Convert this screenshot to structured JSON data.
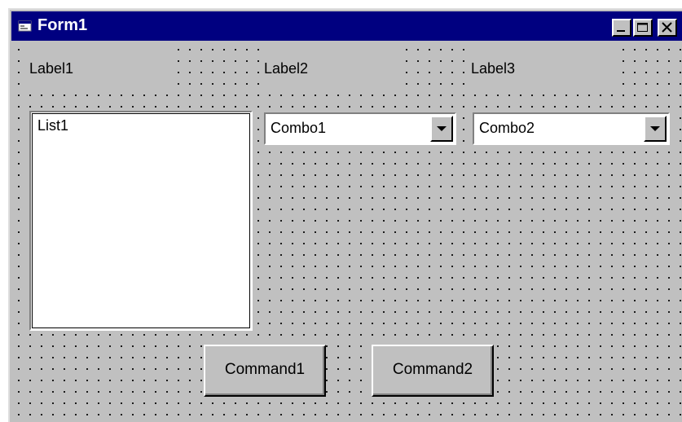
{
  "window": {
    "title": "Form1",
    "controls": {
      "minimize": "minimize",
      "maximize": "maximize",
      "close": "close"
    }
  },
  "labels": [
    "Label1",
    "Label2",
    "Label3"
  ],
  "listbox": {
    "items": [
      "List1"
    ]
  },
  "combos": [
    {
      "value": "Combo1"
    },
    {
      "value": "Combo2"
    }
  ],
  "buttons": [
    "Command1",
    "Command2"
  ],
  "colors": {
    "titlebar": "#000080",
    "face": "#c0c0c0",
    "grid_dot": "#000000"
  }
}
